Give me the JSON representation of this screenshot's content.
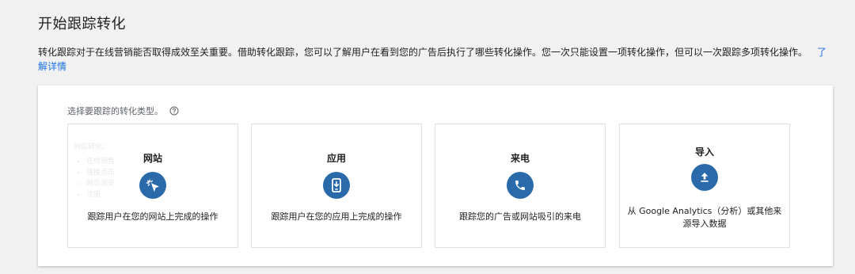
{
  "header": {
    "title": "开始跟踪转化"
  },
  "intro": {
    "text": "转化跟踪对于在线营销能否取得成效至关重要。借助转化跟踪，您可以了解用户在看到您的广告后执行了哪些转化操作。您一次只能设置一项转化操作，但可以一次跟踪多项转化操作。",
    "learn_more": "了解详情"
  },
  "panel": {
    "prompt": "选择要跟踪的转化类型。",
    "help_icon": "help-circle-icon",
    "cards": [
      {
        "title": "网站",
        "icon": "cursor-click-icon",
        "desc": "跟踪用户在您的网站上完成的操作"
      },
      {
        "title": "应用",
        "icon": "mobile-app-icon",
        "desc": "跟踪用户在您的应用上完成的操作"
      },
      {
        "title": "来电",
        "icon": "phone-icon",
        "desc": "跟踪您的广告或网站吸引的来电"
      },
      {
        "title": "导入",
        "icon": "upload-icon",
        "desc": "从 Google Analytics（分析）或其他来源导入数据"
      }
    ],
    "ghost_hint": {
      "heading": "网站转化：",
      "items": [
        "在线销售",
        "链接点击",
        "网页浏览",
        "注册"
      ]
    }
  },
  "colors": {
    "accent": "#1a73e8",
    "icon_bg": "#2a6aab",
    "background": "#f1f1f1"
  }
}
